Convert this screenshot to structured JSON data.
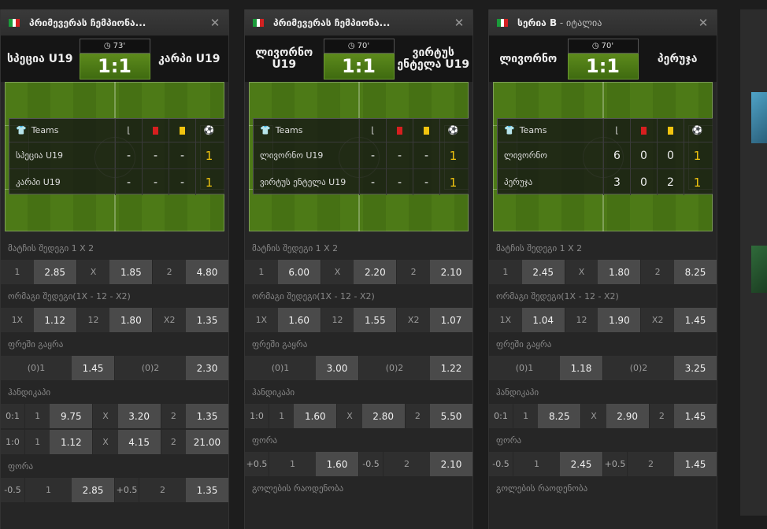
{
  "cards": [
    {
      "league": "პრიმევერას ჩემპიონა...",
      "home": "სპეცია U19",
      "away": "კარპი U19",
      "minute": "73'",
      "score": "1:1",
      "stats_header": "Teams",
      "rows": [
        {
          "team": "სპეცია U19",
          "corners": "-",
          "red": "-",
          "yellow": "-",
          "goals": "1"
        },
        {
          "team": "კარპი U19",
          "corners": "-",
          "red": "-",
          "yellow": "-",
          "goals": "1"
        }
      ],
      "m_result": "მატჩის შედეგი 1 X 2",
      "result": [
        {
          "l": "1",
          "o": "2.85"
        },
        {
          "l": "X",
          "o": "1.85"
        },
        {
          "l": "2",
          "o": "4.80"
        }
      ],
      "m_double": "ორმაგი შედეგი(1X - 12 - X2)",
      "double": [
        {
          "l": "1X",
          "o": "1.12"
        },
        {
          "l": "12",
          "o": "1.80"
        },
        {
          "l": "X2",
          "o": "1.35"
        }
      ],
      "m_dnb": "ფრეში გაყრა",
      "dnb": [
        {
          "l": "(0)1",
          "o": "1.45"
        },
        {
          "l": "(0)2",
          "o": "2.30"
        }
      ],
      "m_handicap": "ჰანდიკაპი",
      "handicap": [
        {
          "h": "0:1",
          "c": [
            {
              "l": "1",
              "o": "9.75"
            },
            {
              "l": "X",
              "o": "3.20"
            },
            {
              "l": "2",
              "o": "1.35"
            }
          ]
        },
        {
          "h": "1:0",
          "c": [
            {
              "l": "1",
              "o": "1.12"
            },
            {
              "l": "X",
              "o": "4.15"
            },
            {
              "l": "2",
              "o": "21.00"
            }
          ]
        }
      ],
      "m_fora": "ფორა",
      "fora": [
        {
          "l": "-0.5",
          "o": ""
        },
        {
          "l": "1",
          "o": "2.85"
        },
        {
          "l": "+0.5",
          "o": ""
        },
        {
          "l": "2",
          "o": "1.35"
        }
      ]
    },
    {
      "league": "პრიმევერას ჩემპიონა...",
      "home": "ლივორნო U19",
      "away": "ვირტუს ენტელა U19",
      "minute": "70'",
      "score": "1:1",
      "stats_header": "Teams",
      "rows": [
        {
          "team": "ლივორნო U19",
          "corners": "-",
          "red": "-",
          "yellow": "-",
          "goals": "1"
        },
        {
          "team": "ვირტუს ენტელა U19",
          "corners": "-",
          "red": "-",
          "yellow": "-",
          "goals": "1"
        }
      ],
      "m_result": "მატჩის შედეგი 1 X 2",
      "result": [
        {
          "l": "1",
          "o": "6.00"
        },
        {
          "l": "X",
          "o": "2.20"
        },
        {
          "l": "2",
          "o": "2.10"
        }
      ],
      "m_double": "ორმაგი შედეგი(1X - 12 - X2)",
      "double": [
        {
          "l": "1X",
          "o": "1.60"
        },
        {
          "l": "12",
          "o": "1.55"
        },
        {
          "l": "X2",
          "o": "1.07"
        }
      ],
      "m_dnb": "ფრეში გაყრა",
      "dnb": [
        {
          "l": "(0)1",
          "o": "3.00"
        },
        {
          "l": "(0)2",
          "o": "1.22"
        }
      ],
      "m_handicap": "ჰანდიკაპი",
      "handicap": [
        {
          "h": "1:0",
          "c": [
            {
              "l": "1",
              "o": "1.60"
            },
            {
              "l": "X",
              "o": "2.80"
            },
            {
              "l": "2",
              "o": "5.50"
            }
          ]
        }
      ],
      "m_fora": "ფორა",
      "fora": [
        {
          "l": "+0.5",
          "o": ""
        },
        {
          "l": "1",
          "o": "1.60"
        },
        {
          "l": "-0.5",
          "o": ""
        },
        {
          "l": "2",
          "o": "2.10"
        }
      ],
      "m_goals": "გოლების რაოდენობა"
    },
    {
      "league": "სერია B",
      "league_sub": " - იტალია",
      "home": "ლივორნო",
      "away": "პერუჯა",
      "minute": "70'",
      "score": "1:1",
      "stats_header": "Teams",
      "rows": [
        {
          "team": "ლივორნო",
          "corners": "6",
          "red": "0",
          "yellow": "0",
          "goals": "1"
        },
        {
          "team": "პერუჯა",
          "corners": "3",
          "red": "0",
          "yellow": "2",
          "goals": "1"
        }
      ],
      "m_result": "მატჩის შედეგი 1 X 2",
      "result": [
        {
          "l": "1",
          "o": "2.45"
        },
        {
          "l": "X",
          "o": "1.80"
        },
        {
          "l": "2",
          "o": "8.25"
        }
      ],
      "m_double": "ორმაგი შედეგი(1X - 12 - X2)",
      "double": [
        {
          "l": "1X",
          "o": "1.04"
        },
        {
          "l": "12",
          "o": "1.90"
        },
        {
          "l": "X2",
          "o": "1.45"
        }
      ],
      "m_dnb": "ფრეში გაყრა",
      "dnb": [
        {
          "l": "(0)1",
          "o": "1.18"
        },
        {
          "l": "(0)2",
          "o": "3.25"
        }
      ],
      "m_handicap": "ჰანდიკაპი",
      "handicap": [
        {
          "h": "0:1",
          "c": [
            {
              "l": "1",
              "o": "8.25"
            },
            {
              "l": "X",
              "o": "2.90"
            },
            {
              "l": "2",
              "o": "1.45"
            }
          ]
        }
      ],
      "m_fora": "ფორა",
      "fora": [
        {
          "l": "-0.5",
          "o": ""
        },
        {
          "l": "1",
          "o": "2.45"
        },
        {
          "l": "+0.5",
          "o": ""
        },
        {
          "l": "2",
          "o": "1.45"
        }
      ],
      "m_goals": "გოლების რაოდენობა"
    }
  ],
  "icons": {
    "close": "close-icon",
    "clock": "clock-icon",
    "shirt": "shirt-icon",
    "corner": "corner-flag-icon",
    "red": "red-card-icon",
    "yellow": "yellow-card-icon",
    "ball": "ball-icon"
  },
  "colors": {
    "odd_bg": "#4a4a4a",
    "score_green": "#4f7d15",
    "goal_yellow": "#f1c40f",
    "red_card": "#d71f1f"
  }
}
